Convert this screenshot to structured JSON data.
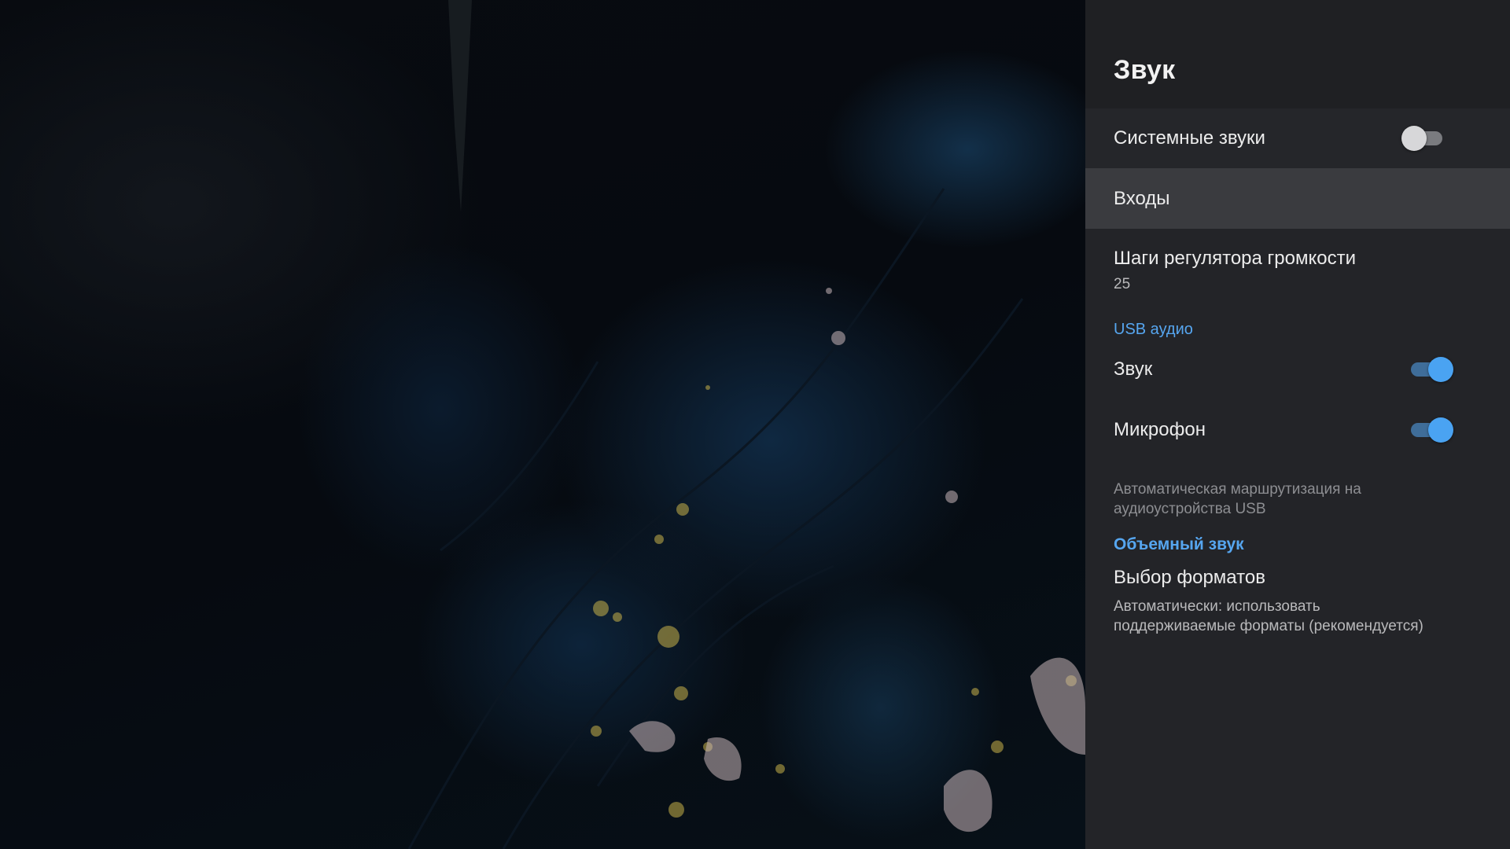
{
  "panel": {
    "title": "Звук",
    "system_sounds": {
      "label": "Системные звуки",
      "enabled": false
    },
    "inputs": {
      "label": "Входы"
    },
    "volume_steps": {
      "label": "Шаги регулятора громкости",
      "value": "25"
    },
    "usb_section": {
      "title": "USB аудио"
    },
    "sound": {
      "label": "Звук",
      "enabled": true
    },
    "microphone": {
      "label": "Микрофон",
      "enabled": true
    },
    "usb_note": {
      "line1": "Автоматическая маршрутизация на",
      "line2": "аудиоустройства USB"
    },
    "surround_section": {
      "title": "Объемный звук"
    },
    "formats": {
      "label": "Выбор форматов",
      "line1": "Автоматически: использовать",
      "line2": "поддерживаемые форматы (рекомендуется)"
    }
  },
  "colors": {
    "panel_bg": "#232428",
    "highlight_row": "#3a3b3f",
    "accent": "#4aa3f2",
    "section_text": "#56a6f0"
  }
}
